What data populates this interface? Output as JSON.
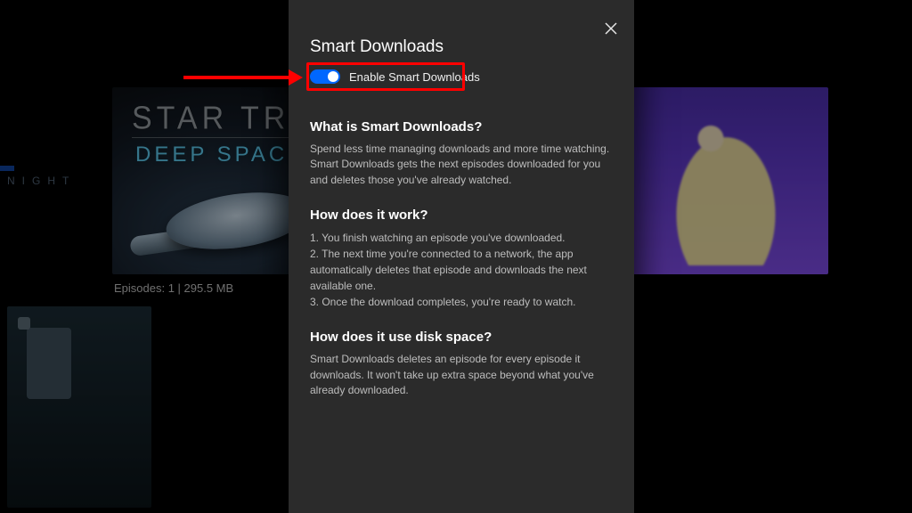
{
  "background": {
    "left_label": "NIGHT",
    "poster_line1": "STAR TREK",
    "poster_line2": "DEEP SPACE NINE",
    "episodes_line": "Episodes: 1 | 295.5 MB"
  },
  "dialog": {
    "title": "Smart Downloads",
    "toggle": {
      "label": "Enable Smart Downloads",
      "on": true
    },
    "sections": {
      "what": {
        "heading": "What is Smart Downloads?",
        "body": "Spend less time managing downloads and more time watching. Smart Downloads gets the next episodes downloaded for you and deletes those you've already watched."
      },
      "how": {
        "heading": "How does it work?",
        "step1": "1. You finish watching an episode you've downloaded.",
        "step2": "2. The next time you're connected to a network, the app automatically deletes that episode and downloads the next available one.",
        "step3": "3. Once the download completes, you're ready to watch."
      },
      "disk": {
        "heading": "How does it use disk space?",
        "body": "Smart Downloads deletes an episode for every episode it downloads. It won't take up extra space beyond what you've already downloaded."
      }
    }
  },
  "annotation": {
    "arrow_color": "#ff0000",
    "box_color": "#ff0000"
  }
}
